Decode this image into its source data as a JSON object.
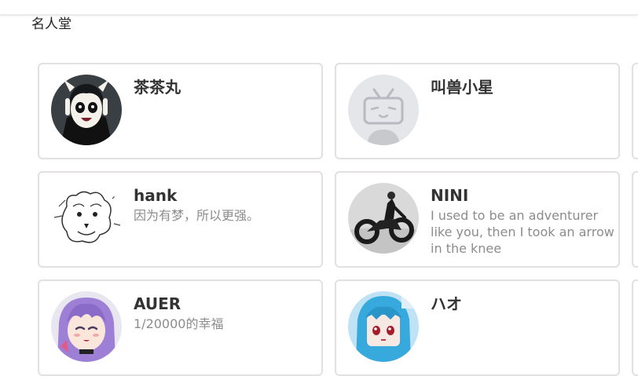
{
  "page": {
    "title": "名人堂"
  },
  "users": [
    {
      "name": "茶茶丸",
      "bio": "",
      "avatar_icon": "goth-girl-avatar-icon"
    },
    {
      "name": "叫兽小星",
      "bio": "",
      "avatar_icon": "bilibili-tv-avatar-icon"
    },
    {
      "name": "hank",
      "bio": "因为有梦，所以更强。",
      "avatar_icon": "sketch-dog-avatar-icon"
    },
    {
      "name": "NINI",
      "bio": "I used to be an adventurer like you, then I took an arrow in the knee",
      "avatar_icon": "motorcycle-rider-avatar-icon"
    },
    {
      "name": "AUER",
      "bio": "1/20000的幸福",
      "avatar_icon": "purple-hair-anime-avatar-icon"
    },
    {
      "name": "ハオ",
      "bio": "",
      "avatar_icon": "blue-hair-anime-avatar-icon"
    }
  ]
}
